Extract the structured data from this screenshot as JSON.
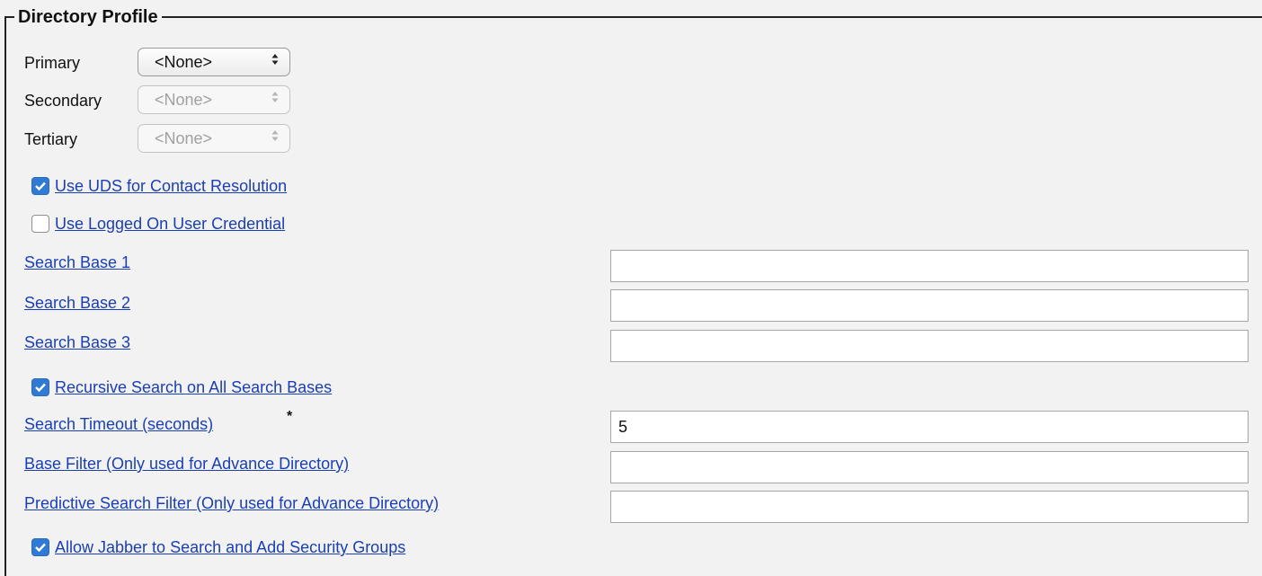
{
  "legend": "Directory Profile",
  "servers": {
    "primary_label": "Primary",
    "primary_value": "<None>",
    "secondary_label": "Secondary",
    "secondary_value": "<None>",
    "tertiary_label": "Tertiary",
    "tertiary_value": "<None>"
  },
  "checkboxes": {
    "use_uds": "Use UDS for Contact Resolution",
    "use_logged_on": "Use Logged On User Credential",
    "recursive": "Recursive Search on All Search Bases",
    "allow_jabber": "Allow Jabber to Search and Add Security Groups"
  },
  "fields": {
    "search_base_1_label": "Search Base 1",
    "search_base_1_value": "",
    "search_base_2_label": "Search Base 2",
    "search_base_2_value": "",
    "search_base_3_label": "Search Base 3",
    "search_base_3_value": "",
    "search_timeout_label": "Search Timeout (seconds)",
    "search_timeout_value": "5",
    "required_marker": "*",
    "base_filter_label": "Base Filter (Only used for Advance Directory)",
    "base_filter_value": "",
    "predictive_filter_label": "Predictive Search Filter (Only used for Advance Directory)",
    "predictive_filter_value": ""
  },
  "colors": {
    "link": "#1a3fb3",
    "checkbox_checked": "#2f7ad5",
    "background": "#f2f2f2"
  }
}
